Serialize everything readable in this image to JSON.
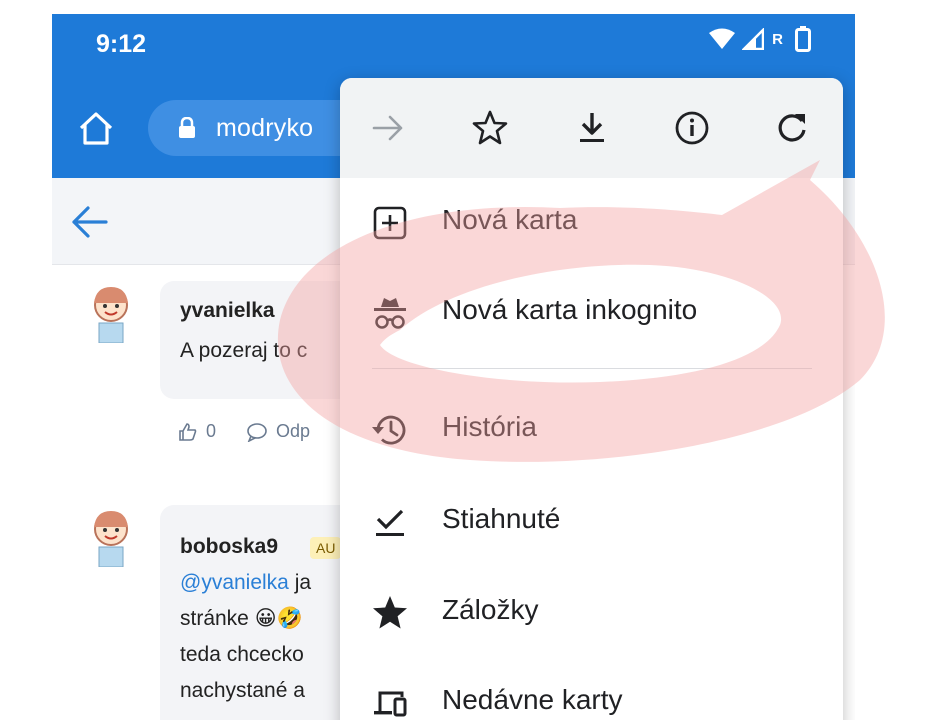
{
  "status_bar": {
    "time": "9:12",
    "carrier_indicator": "R",
    "icons": [
      "wifi-icon",
      "signal-icon",
      "battery-icon"
    ]
  },
  "browser": {
    "url": "modryko",
    "icons": [
      "home-icon",
      "lock-icon"
    ]
  },
  "page": {
    "back_icon": "arrow-left-icon",
    "comments": [
      {
        "username": "yvanielka",
        "text": "A pozeraj to c",
        "likes": "0",
        "reply_label": "Odp"
      },
      {
        "username": "boboska9",
        "badge": "AU",
        "mention": "@yvanielka",
        "lines": [
          "ja",
          "stránke 😀🤣",
          "teda chcecko",
          "nachystané a"
        ]
      }
    ]
  },
  "menu": {
    "top_icons": [
      "forward-icon",
      "bookmark-star-icon",
      "download-icon",
      "info-icon",
      "reload-icon"
    ],
    "items": [
      {
        "label": "Nová karta",
        "icon": "new-tab-icon"
      },
      {
        "label": "Nová karta inkognito",
        "icon": "incognito-icon"
      },
      {
        "label": "História",
        "icon": "history-icon"
      },
      {
        "label": "Stiahnuté",
        "icon": "downloads-check-icon"
      },
      {
        "label": "Záložky",
        "icon": "bookmarks-star-icon"
      },
      {
        "label": "Nedávne karty",
        "icon": "recent-tabs-icon"
      }
    ]
  },
  "colors": {
    "toolbar": "#1e7ad8",
    "urlbar": "#3f8fe3",
    "accent": "#2a7fd6",
    "annotation": "#f5a3a3"
  }
}
